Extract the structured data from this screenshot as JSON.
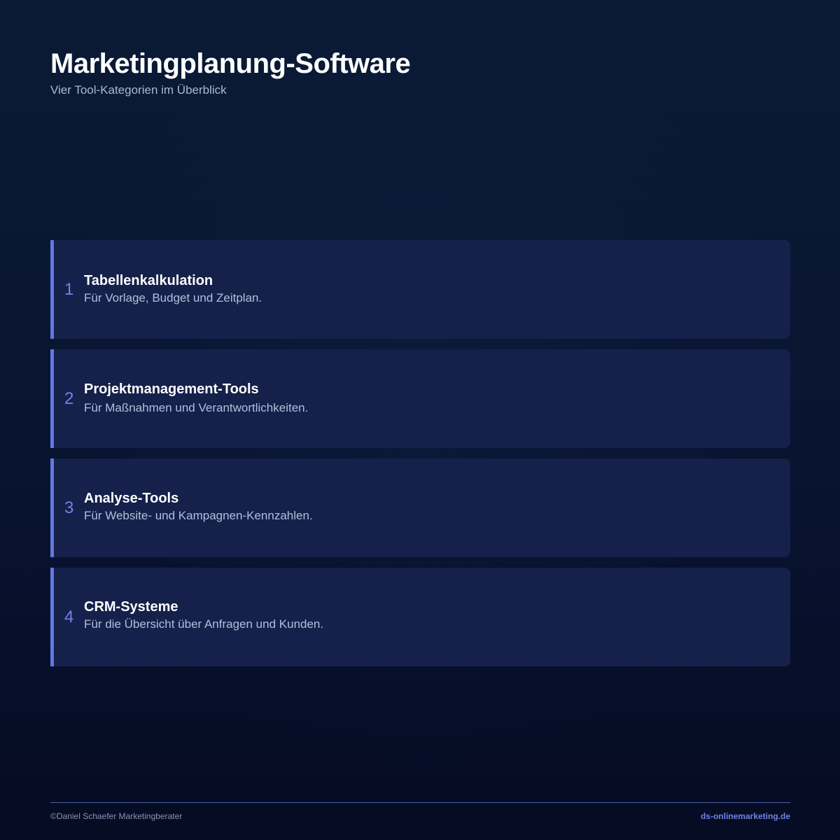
{
  "header": {
    "title": "Marketingplanung-Software",
    "subtitle": "Vier Tool-Kategorien im Überblick"
  },
  "cards": [
    {
      "number": "1",
      "title": "Tabellenkalkulation",
      "description": "Für Vorlage, Budget und Zeitplan."
    },
    {
      "number": "2",
      "title": "Projektmanagement-Tools",
      "description": "Für Maßnahmen und Verantwortlichkeiten."
    },
    {
      "number": "3",
      "title": "Analyse-Tools",
      "description": "Für Website- und Kampagnen-Kennzahlen."
    },
    {
      "number": "4",
      "title": "CRM-Systeme",
      "description": "Für die Übersicht über Anfragen und Kunden."
    }
  ],
  "footer": {
    "copyright": "©Daniel Schaefer Marketingberater",
    "website": "ds-onlinemarketing.de"
  },
  "colors": {
    "accent": "#6478e0",
    "card_background": "#15214a",
    "page_background": "#0a1733"
  }
}
